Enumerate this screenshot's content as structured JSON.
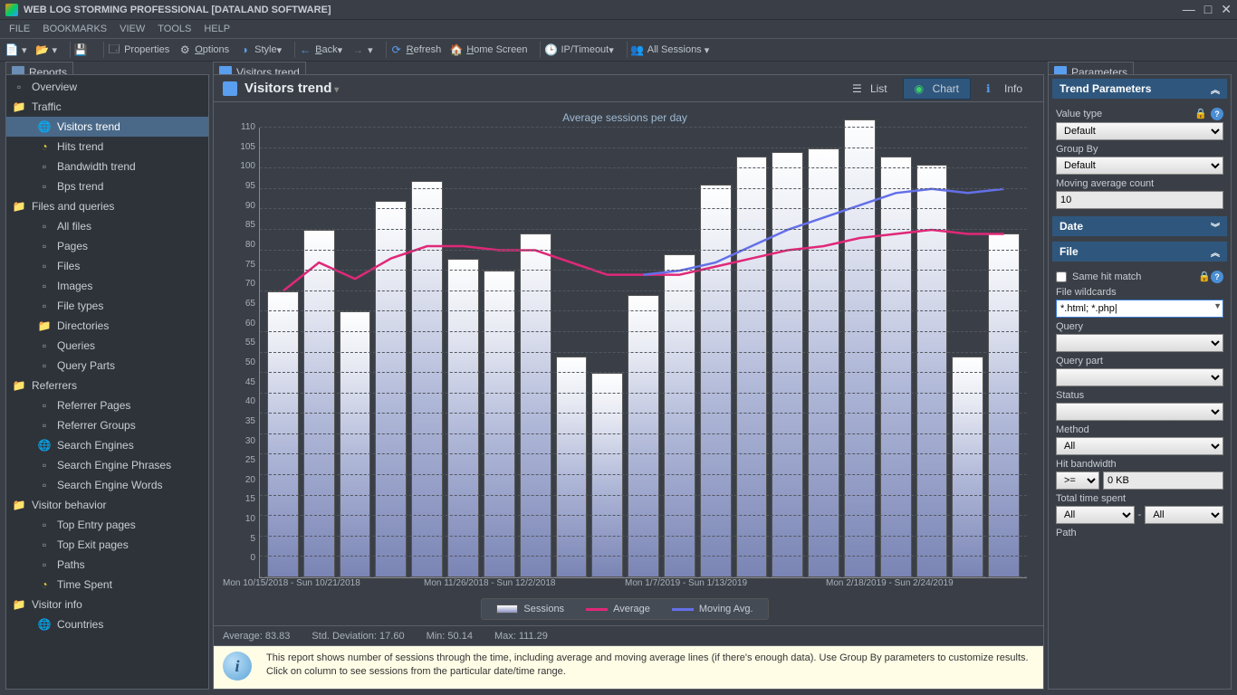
{
  "window": {
    "title": "WEB LOG STORMING PROFESSIONAL [DATALAND SOFTWARE]"
  },
  "menu": {
    "file": "FILE",
    "bookmarks": "BOOKMARKS",
    "view": "VIEW",
    "tools": "TOOLS",
    "help": "HELP"
  },
  "toolbar": {
    "properties": "Properties",
    "options": "Options",
    "style": "Style",
    "back": "Back",
    "refresh": "Refresh",
    "home": "Home Screen",
    "ip_timeout": "IP/Timeout",
    "all_sessions": "All Sessions"
  },
  "left_panel": {
    "tab": "Reports",
    "items": [
      {
        "label": "Overview",
        "type": "doc",
        "sub": false
      },
      {
        "label": "Traffic",
        "type": "folder",
        "sub": false
      },
      {
        "label": "Visitors trend",
        "type": "globe",
        "sub": true,
        "selected": true
      },
      {
        "label": "Hits trend",
        "type": "yellow",
        "sub": true
      },
      {
        "label": "Bandwidth trend",
        "type": "doc",
        "sub": true
      },
      {
        "label": "Bps trend",
        "type": "doc",
        "sub": true
      },
      {
        "label": "Files and queries",
        "type": "folder",
        "sub": false
      },
      {
        "label": "All files",
        "type": "doc",
        "sub": true
      },
      {
        "label": "Pages",
        "type": "doc",
        "sub": true
      },
      {
        "label": "Files",
        "type": "doc",
        "sub": true
      },
      {
        "label": "Images",
        "type": "doc",
        "sub": true
      },
      {
        "label": "File types",
        "type": "doc",
        "sub": true
      },
      {
        "label": "Directories",
        "type": "folder",
        "sub": true
      },
      {
        "label": "Queries",
        "type": "doc",
        "sub": true
      },
      {
        "label": "Query Parts",
        "type": "doc",
        "sub": true
      },
      {
        "label": "Referrers",
        "type": "folder",
        "sub": false
      },
      {
        "label": "Referrer Pages",
        "type": "doc",
        "sub": true
      },
      {
        "label": "Referrer Groups",
        "type": "doc",
        "sub": true
      },
      {
        "label": "Search Engines",
        "type": "globe",
        "sub": true
      },
      {
        "label": "Search Engine Phrases",
        "type": "doc",
        "sub": true
      },
      {
        "label": "Search Engine Words",
        "type": "doc",
        "sub": true
      },
      {
        "label": "Visitor behavior",
        "type": "folder",
        "sub": false
      },
      {
        "label": "Top Entry pages",
        "type": "doc",
        "sub": true
      },
      {
        "label": "Top Exit pages",
        "type": "doc",
        "sub": true
      },
      {
        "label": "Paths",
        "type": "doc",
        "sub": true
      },
      {
        "label": "Time Spent",
        "type": "yellow",
        "sub": true
      },
      {
        "label": "Visitor info",
        "type": "folder",
        "sub": false
      },
      {
        "label": "Countries",
        "type": "globe",
        "sub": true
      }
    ]
  },
  "center": {
    "tab": "Visitors trend",
    "title": "Visitors trend",
    "views": {
      "list": "List",
      "chart": "Chart",
      "info": "Info"
    },
    "stats": {
      "average_label": "Average:",
      "average_value": "83.83",
      "stddev_label": "Std. Deviation:",
      "stddev_value": "17.60",
      "min_label": "Min:",
      "min_value": "50.14",
      "max_label": "Max:",
      "max_value": "111.29"
    },
    "info_text": "This report shows number of sessions through the time, including average and moving average lines (if there's enough data). Use Group By parameters to customize results. Click on column to see sessions from the particular date/time range."
  },
  "chart_data": {
    "type": "bar",
    "title": "Average sessions per day",
    "ylim": [
      0,
      110
    ],
    "yticks": [
      0,
      5,
      10,
      15,
      20,
      25,
      30,
      35,
      40,
      45,
      50,
      55,
      60,
      65,
      70,
      75,
      80,
      85,
      90,
      95,
      100,
      105,
      110
    ],
    "categories_visible": [
      "Mon 10/15/2018 - Sun 10/21/2018",
      "Mon 11/26/2018 - Sun 12/2/2018",
      "Mon 1/7/2019 - Sun 1/13/2019",
      "Mon 2/18/2019 - Sun 2/24/2019"
    ],
    "series": [
      {
        "name": "Sessions",
        "color": "#9aa3cc",
        "style": "bar",
        "values": [
          70,
          85,
          65,
          92,
          97,
          78,
          75,
          84,
          54,
          50,
          69,
          79,
          96,
          103,
          104,
          105,
          112,
          103,
          101,
          54,
          84
        ]
      },
      {
        "name": "Average",
        "color": "#e02878",
        "style": "line",
        "values": [
          70,
          77,
          73,
          78,
          81,
          81,
          80,
          80,
          77,
          74,
          74,
          74,
          76,
          78,
          80,
          81,
          83,
          84,
          85,
          84,
          84
        ]
      },
      {
        "name": "Moving Avg.",
        "color": "#6470e8",
        "style": "line",
        "values": [
          null,
          null,
          null,
          null,
          null,
          null,
          null,
          null,
          null,
          null,
          74,
          75,
          77,
          81,
          85,
          88,
          91,
          94,
          95,
          94,
          95
        ]
      }
    ],
    "legend": [
      "Sessions",
      "Average",
      "Moving Avg."
    ]
  },
  "right_panel": {
    "tab": "Parameters",
    "sections": {
      "trend": {
        "title": "Trend Parameters",
        "value_type_label": "Value type",
        "value_type": "Default",
        "group_by_label": "Group By",
        "group_by": "Default",
        "mavg_label": "Moving average count",
        "mavg": "10"
      },
      "date": {
        "title": "Date"
      },
      "file": {
        "title": "File",
        "same_hit_label": "Same hit match",
        "wildcards_label": "File wildcards",
        "wildcards": "*.html; *.php|",
        "query_label": "Query",
        "query": "",
        "query_part_label": "Query part",
        "query_part": "",
        "status_label": "Status",
        "status": "",
        "method_label": "Method",
        "method": "All",
        "hitbw_label": "Hit bandwidth",
        "hitbw_op": ">=",
        "hitbw_val": "0 KB",
        "tts_label": "Total time spent",
        "tts_from": "All",
        "tts_sep": "-",
        "tts_to": "All",
        "path_label": "Path"
      }
    }
  }
}
